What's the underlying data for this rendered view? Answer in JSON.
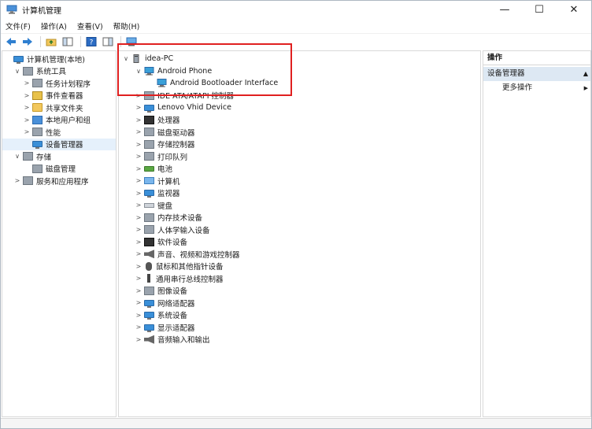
{
  "window": {
    "title": "计算机管理",
    "minimize": "—",
    "maximize": "☐",
    "close": "✕"
  },
  "menu": [
    "文件(F)",
    "操作(A)",
    "查看(V)",
    "帮助(H)"
  ],
  "left_tree": [
    {
      "label": "计算机管理(本地)",
      "indent": 0,
      "chevron": "",
      "icon": "computer-management-icon"
    },
    {
      "label": "系统工具",
      "indent": 1,
      "chevron": "∨",
      "icon": "tools-icon"
    },
    {
      "label": "任务计划程序",
      "indent": 2,
      "chevron": ">",
      "icon": "task-scheduler-icon"
    },
    {
      "label": "事件查看器",
      "indent": 2,
      "chevron": ">",
      "icon": "event-viewer-icon"
    },
    {
      "label": "共享文件夹",
      "indent": 2,
      "chevron": ">",
      "icon": "shared-folder-icon"
    },
    {
      "label": "本地用户和组",
      "indent": 2,
      "chevron": ">",
      "icon": "users-icon"
    },
    {
      "label": "性能",
      "indent": 2,
      "chevron": ">",
      "icon": "performance-icon"
    },
    {
      "label": "设备管理器",
      "indent": 2,
      "chevron": "",
      "icon": "device-manager-icon",
      "selected": true
    },
    {
      "label": "存储",
      "indent": 1,
      "chevron": "∨",
      "icon": "storage-icon"
    },
    {
      "label": "磁盘管理",
      "indent": 2,
      "chevron": "",
      "icon": "disk-management-icon"
    },
    {
      "label": "服务和应用程序",
      "indent": 1,
      "chevron": ">",
      "icon": "services-icon"
    }
  ],
  "device_tree": {
    "root": "idea-PC",
    "android_phone": "Android Phone",
    "android_child": "Android Bootloader Interface",
    "categories": [
      {
        "label": "IDE ATA/ATAPI 控制器",
        "icon": "ide-controller-icon"
      },
      {
        "label": "Lenovo Vhid Device",
        "icon": "lenovo-vhid-icon"
      },
      {
        "label": "处理器",
        "icon": "processor-icon"
      },
      {
        "label": "磁盘驱动器",
        "icon": "disk-drive-icon"
      },
      {
        "label": "存储控制器",
        "icon": "storage-controller-icon"
      },
      {
        "label": "打印队列",
        "icon": "print-queue-icon"
      },
      {
        "label": "电池",
        "icon": "battery-icon"
      },
      {
        "label": "计算机",
        "icon": "computer-icon"
      },
      {
        "label": "监视器",
        "icon": "monitor-icon"
      },
      {
        "label": "键盘",
        "icon": "keyboard-icon"
      },
      {
        "label": "内存技术设备",
        "icon": "memory-device-icon"
      },
      {
        "label": "人体学输入设备",
        "icon": "hid-icon"
      },
      {
        "label": "软件设备",
        "icon": "software-device-icon"
      },
      {
        "label": "声音、视频和游戏控制器",
        "icon": "sound-controller-icon"
      },
      {
        "label": "鼠标和其他指针设备",
        "icon": "mouse-icon"
      },
      {
        "label": "通用串行总线控制器",
        "icon": "usb-controller-icon"
      },
      {
        "label": "图像设备",
        "icon": "imaging-device-icon"
      },
      {
        "label": "网络适配器",
        "icon": "network-adapter-icon"
      },
      {
        "label": "系统设备",
        "icon": "system-device-icon"
      },
      {
        "label": "显示适配器",
        "icon": "display-adapter-icon"
      },
      {
        "label": "音频输入和输出",
        "icon": "audio-io-icon"
      }
    ]
  },
  "actions": {
    "header": "操作",
    "selected": "设备管理器",
    "more": "更多操作"
  },
  "colors": {
    "highlight_border": "#e02020",
    "selection_bg": "#e5f0fb",
    "actions_selected_bg": "#dde8f3"
  }
}
